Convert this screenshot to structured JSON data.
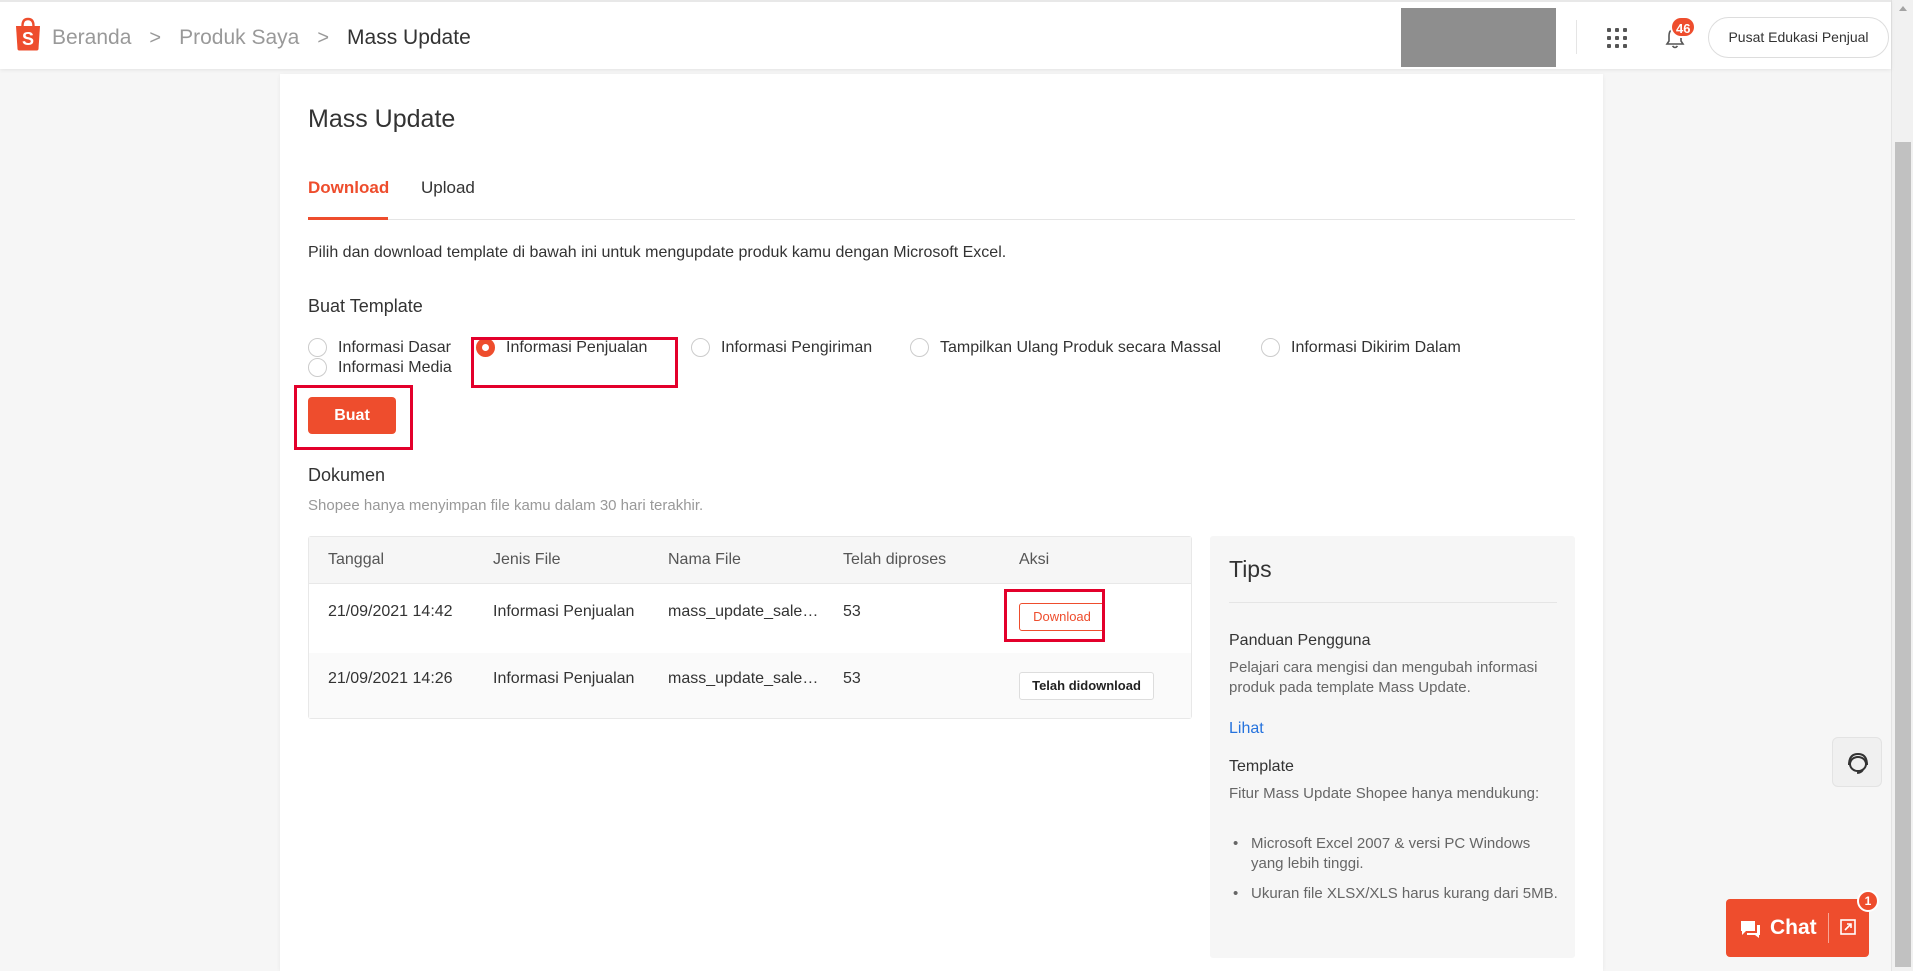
{
  "breadcrumb": {
    "home": "Beranda",
    "products": "Produk Saya",
    "current": "Mass Update"
  },
  "header": {
    "notifications_count": "46",
    "edu_button": "Pusat Edukasi Penjual"
  },
  "colors": {
    "accent": "#ee4d2d",
    "highlight": "#e3002b",
    "link": "#2673dd"
  },
  "page": {
    "title": "Mass Update",
    "tabs": [
      {
        "label": "Download",
        "active": true
      },
      {
        "label": "Upload",
        "active": false
      }
    ],
    "description": "Pilih dan download template di bawah ini untuk mengupdate produk kamu dengan Microsoft Excel."
  },
  "template": {
    "title": "Buat Template",
    "options": [
      {
        "label": "Informasi Dasar",
        "checked": false
      },
      {
        "label": "Informasi Penjualan",
        "checked": true
      },
      {
        "label": "Informasi Pengiriman",
        "checked": false
      },
      {
        "label": "Tampilkan Ulang Produk secara Massal",
        "checked": false
      },
      {
        "label": "Informasi Dikirim Dalam",
        "checked": false
      },
      {
        "label": "Informasi Media",
        "checked": false
      }
    ],
    "button": "Buat"
  },
  "documents": {
    "title": "Dokumen",
    "note": "Shopee hanya menyimpan file kamu dalam 30 hari terakhir.",
    "columns": [
      "Tanggal",
      "Jenis File",
      "Nama File",
      "Telah diproses",
      "Aksi"
    ],
    "rows": [
      {
        "date": "21/09/2021 14:42",
        "type": "Informasi Penjualan",
        "name": "mass_update_sale…",
        "processed": "53",
        "action": "Download"
      },
      {
        "date": "21/09/2021 14:26",
        "type": "Informasi Penjualan",
        "name": "mass_update_sale…",
        "processed": "53",
        "action": "Telah didownload"
      }
    ]
  },
  "tips": {
    "title": "Tips",
    "guide_title": "Panduan Pengguna",
    "guide_text": "Pelajari cara mengisi dan mengubah informasi produk pada template Mass Update.",
    "guide_link": "Lihat",
    "template_title": "Template",
    "template_text": "Fitur Mass Update Shopee hanya mendukung:",
    "bullets": [
      "Microsoft Excel 2007 & versi PC Windows yang lebih tinggi.",
      "Ukuran file XLSX/XLS harus kurang dari 5MB."
    ]
  },
  "chat": {
    "label": "Chat",
    "badge": "1"
  },
  "icons": {
    "logo": "shopee-bag-icon",
    "apps": "apps-grid-icon",
    "bell": "bell-icon",
    "support": "headset-icon",
    "chat": "chat-bubble-icon",
    "expand": "expand-icon"
  }
}
